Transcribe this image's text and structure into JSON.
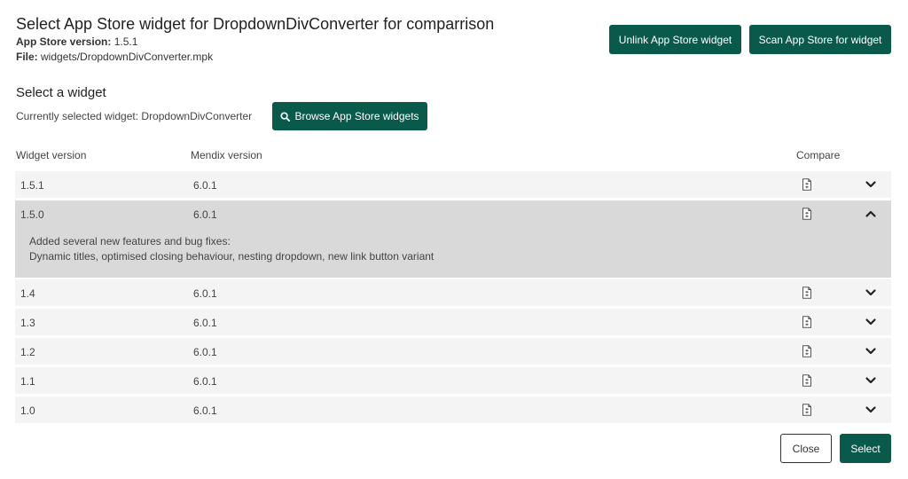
{
  "dialog": {
    "title": "Select App Store widget for DropdownDivConverter for comparrison",
    "version_label": "App Store version:",
    "version_value": "1.5.1",
    "file_label": "File:",
    "file_value": "widgets/DropdownDivConverter.mpk"
  },
  "header_buttons": {
    "unlink": "Unlink App Store widget",
    "scan": "Scan App Store for widget"
  },
  "selection": {
    "heading": "Select a widget",
    "current_text": "Currently selected widget: DropdownDivConverter",
    "browse_label": "Browse App Store widgets"
  },
  "table": {
    "columns": {
      "widget_version": "Widget version",
      "mendix_version": "Mendix version",
      "compare": "Compare"
    },
    "rows": [
      {
        "version": "1.5.1",
        "mendix": "6.0.1",
        "expanded": false
      },
      {
        "version": "1.5.0",
        "mendix": "6.0.1",
        "expanded": true,
        "notes_line1": "Added several new features and bug fixes:",
        "notes_line2": "Dynamic titles, optimised closing behaviour, nesting dropdown, new link button variant"
      },
      {
        "version": "1.4",
        "mendix": "6.0.1",
        "expanded": false
      },
      {
        "version": "1.3",
        "mendix": "6.0.1",
        "expanded": false
      },
      {
        "version": "1.2",
        "mendix": "6.0.1",
        "expanded": false
      },
      {
        "version": "1.1",
        "mendix": "6.0.1",
        "expanded": false
      },
      {
        "version": "1.0",
        "mendix": "6.0.1",
        "expanded": false
      }
    ]
  },
  "footer": {
    "close_label": "Close",
    "select_label": "Select"
  },
  "colors": {
    "accent": "#0a5a4c",
    "row_bg": "#f4f4f4",
    "row_expanded_bg": "#d9d9d9"
  },
  "icons": {
    "compare": "document-compare-icon",
    "expand": "chevron-down-icon",
    "collapse": "chevron-up-icon",
    "browse": "search-icon"
  }
}
